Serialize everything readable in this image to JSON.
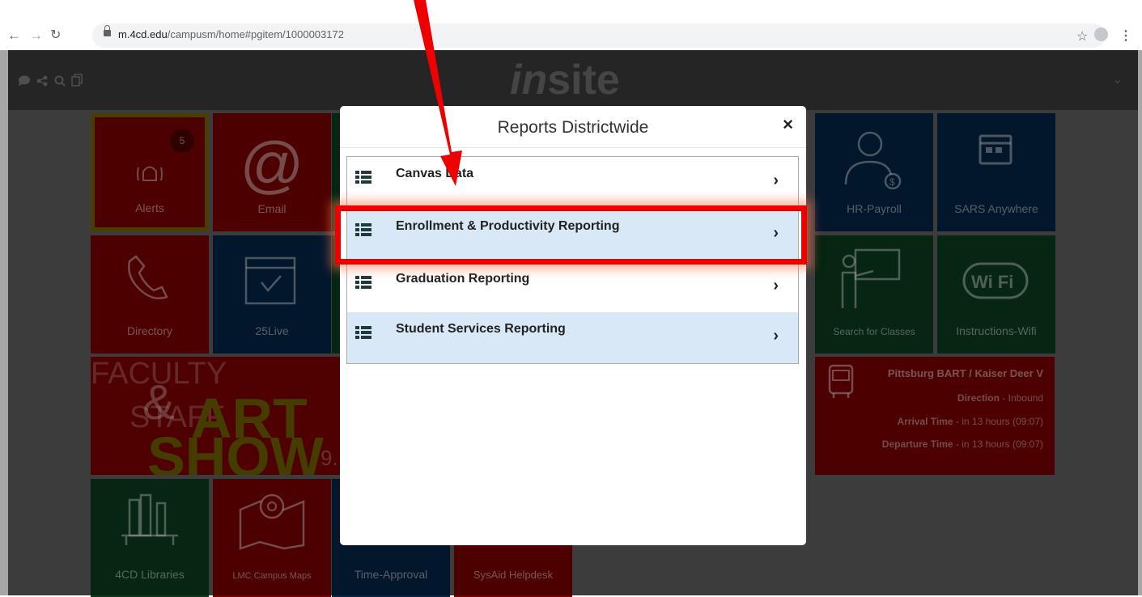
{
  "browser": {
    "url_domain": "m.4cd.edu",
    "url_path": "/campusm/home#pgitem/1000003172"
  },
  "header": {
    "logo_text": "site",
    "logo_prefix": "in"
  },
  "tiles": {
    "alerts": {
      "label": "Alerts",
      "badge": "5"
    },
    "email": {
      "label": "Email"
    },
    "hr_payroll": {
      "label": "HR-Payroll"
    },
    "sars": {
      "label": "SARS Anywhere"
    },
    "directory": {
      "label": "Directory"
    },
    "live25": {
      "label": "25Live"
    },
    "search_classes": {
      "label": "Search for Classes"
    },
    "wifi": {
      "label": "Instructions-Wifi"
    },
    "libraries": {
      "label": "4CD Libraries"
    },
    "campus_maps": {
      "label": "LMC Campus Maps"
    },
    "time_approval": {
      "label": "Time-Approval"
    },
    "sysaid": {
      "label": "SysAid Helpdesk"
    },
    "art_show": {
      "line1": "FACULTY",
      "amp": "&",
      "line2": "STAFF",
      "art": "ART",
      "show": "SHOW",
      "suffix": "9."
    },
    "bart": {
      "title": "Pittsburg BART / Kaiser Deer V",
      "direction_label": "Direction",
      "direction_value": "- Inbound",
      "arrival_label": "Arrival Time",
      "arrival_value": "- in 13 hours (09:07)",
      "departure_label": "Departure Time",
      "departure_value": "- in 13 hours (09:07)"
    }
  },
  "modal": {
    "title": "Reports Districtwide",
    "close": "×",
    "items": [
      {
        "label": "Canvas Data"
      },
      {
        "label": "Enrollment & Productivity Reporting"
      },
      {
        "label": "Graduation Reporting"
      },
      {
        "label": "Student Services Reporting"
      }
    ]
  },
  "colors": {
    "highlight": "#ee0000",
    "tile_red": "#770000",
    "tile_navy": "#062444",
    "tile_green": "#0a3a1d"
  }
}
